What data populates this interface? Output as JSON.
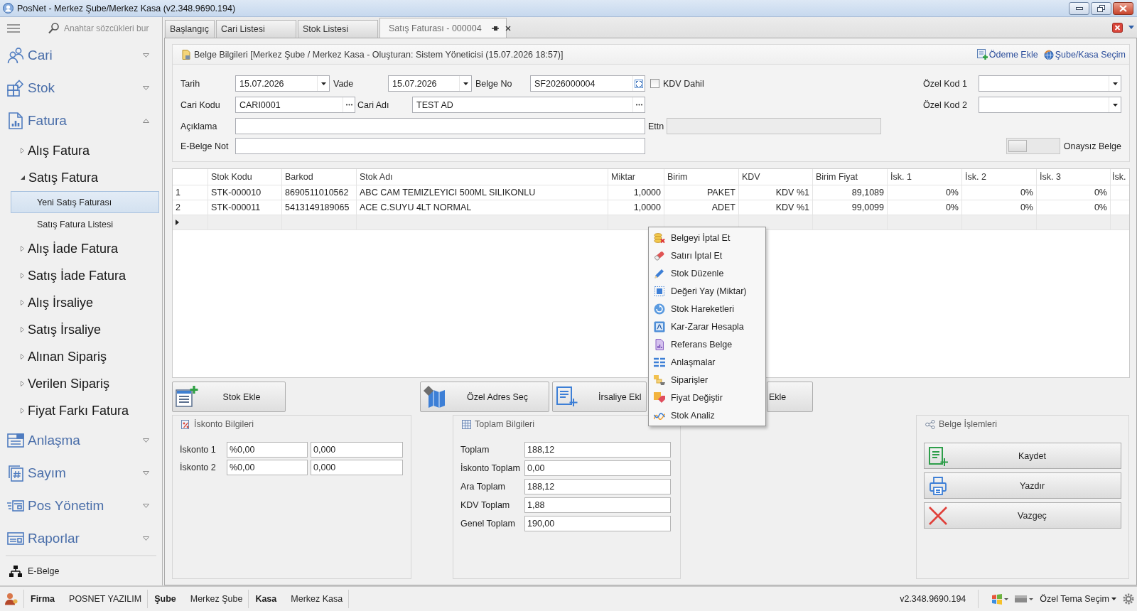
{
  "window": {
    "title": "PosNet - Merkez Şube/Merkez Kasa (v2.348.9690.194)"
  },
  "sidebar": {
    "search": {
      "placeholder": "Anahtar sözcükleri bur"
    },
    "groups": [
      {
        "label": "Cari",
        "expanded": false
      },
      {
        "label": "Stok",
        "expanded": false
      },
      {
        "label": "Fatura",
        "expanded": true,
        "children": [
          {
            "label": "Alış Fatura",
            "expanded": false
          },
          {
            "label": "Satış Fatura",
            "expanded": true,
            "children": [
              {
                "label": "Yeni Satış Faturası",
                "selected": true
              },
              {
                "label": "Satış Fatura Listesi",
                "selected": false
              }
            ]
          },
          {
            "label": "Alış İade Fatura",
            "expanded": false
          },
          {
            "label": "Satış İade Fatura",
            "expanded": false
          },
          {
            "label": "Alış İrsaliye",
            "expanded": false
          },
          {
            "label": "Satış İrsaliye",
            "expanded": false
          },
          {
            "label": "Alınan Sipariş",
            "expanded": false
          },
          {
            "label": "Verilen Sipariş",
            "expanded": false
          },
          {
            "label": "Fiyat Farkı Fatura",
            "expanded": false
          }
        ]
      },
      {
        "label": "Anlaşma",
        "expanded": false
      },
      {
        "label": "Sayım",
        "expanded": false
      },
      {
        "label": "Pos Yönetim",
        "expanded": false
      },
      {
        "label": "Raporlar",
        "expanded": false
      }
    ],
    "footer_item": {
      "label": "E-Belge"
    }
  },
  "tabs": [
    {
      "label": "Başlangıç",
      "selected": false
    },
    {
      "label": "Cari Listesi",
      "selected": false
    },
    {
      "label": "Stok Listesi",
      "selected": false
    },
    {
      "label": "Satış Faturası - 000004",
      "selected": true
    }
  ],
  "document_panel": {
    "title": "Belge Bilgileri [Merkez Şube / Merkez Kasa - Oluşturan: Sistem Yöneticisi (15.07.2026 18:57)]",
    "links": [
      "Ödeme Ekle",
      "Şube/Kasa Seçim"
    ],
    "fields": {
      "date": {
        "label": "Tarih",
        "value": "15.07.2026"
      },
      "due_date": {
        "label": "Vade",
        "value": "15.07.2026"
      },
      "document_no": {
        "label": "Belge No",
        "value": "SF2026000004"
      },
      "vat_included": {
        "label": "KDV Dahil",
        "checked": false
      },
      "special_code_1": {
        "label": "Özel Kod 1"
      },
      "account_code": {
        "label": "Cari Kodu",
        "value": "CARI0001"
      },
      "account_name": {
        "label": "Cari Adı",
        "value": "TEST AD"
      },
      "special_code_2": {
        "label": "Özel Kod 2"
      },
      "description": {
        "label": "Açıklama"
      },
      "ettn": {
        "label": "Ettn",
        "disabled": true
      },
      "e_document_note": {
        "label": "E-Belge Not"
      },
      "unapproved": {
        "label": "Onaysız Belge",
        "on": false
      }
    }
  },
  "table": {
    "columns": [
      "Stok Kodu",
      "Barkod",
      "Stok Adı",
      "Miktar",
      "Birim",
      "KDV",
      "Birim Fiyat",
      "İsk. 1",
      "İsk. 2",
      "İsk. 3",
      "İsk."
    ],
    "rows": [
      {
        "number": "1",
        "current": false,
        "cells": [
          "STK-000010",
          "8690511010562",
          "ABC CAM TEMIZLEYICI 500ML SILIKONLU",
          "1,0000",
          "PAKET",
          "KDV %1",
          "89,1089",
          "0%",
          "0%",
          "0%"
        ]
      },
      {
        "number": "2",
        "current": false,
        "cells": [
          "STK-000011",
          "5413149189065",
          "ACE C.SUYU 4LT NORMAL",
          "1,0000",
          "ADET",
          "KDV %1",
          "99,0099",
          "0%",
          "0%",
          "0%"
        ]
      }
    ],
    "new_row": {
      "current": true
    }
  },
  "actions": [
    "Stok Ekle",
    "Özel Adres Seç",
    "İrsaliye Ekl",
    "Ekle"
  ],
  "context_menu": {
    "items": [
      "Belgeyi İptal Et",
      "Satırı İptal Et",
      "Stok Düzenle",
      "Değeri Yay (Miktar)",
      "Stok Hareketleri",
      "Kar-Zarar Hesapla",
      "Referans Belge",
      "Anlaşmalar",
      "Siparişler",
      "Fiyat Değiştir",
      "Stok Analiz"
    ]
  },
  "discount_panel": {
    "title": "İskonto Bilgileri",
    "rows": [
      {
        "label": "İskonto 1",
        "rate": "%0,00",
        "amount": "0,000"
      },
      {
        "label": "İskonto 2",
        "rate": "%0,00",
        "amount": "0,000"
      }
    ]
  },
  "totals_panel": {
    "title": "Toplam Bilgileri",
    "rows": [
      {
        "label": "Toplam",
        "value": "188,12"
      },
      {
        "label": "İskonto Toplam",
        "value": "0,00"
      },
      {
        "label": "Ara Toplam",
        "value": "188,12"
      },
      {
        "label": "KDV Toplam",
        "value": "1,88"
      },
      {
        "label": "Genel Toplam",
        "value": "190,00"
      }
    ]
  },
  "document_actions": {
    "title": "Belge İşlemleri",
    "buttons": [
      "Kaydet",
      "Yazdır",
      "Vazgeç"
    ]
  },
  "status_bar": {
    "fields": [
      {
        "label": "Firma",
        "value": "POSNET YAZILIM"
      },
      {
        "label": "Şube",
        "value": "Merkez Şube"
      },
      {
        "label": "Kasa",
        "value": "Merkez Kasa"
      }
    ],
    "version": "v2.348.9690.194",
    "theme_menu": "Özel Tema Seçim"
  }
}
